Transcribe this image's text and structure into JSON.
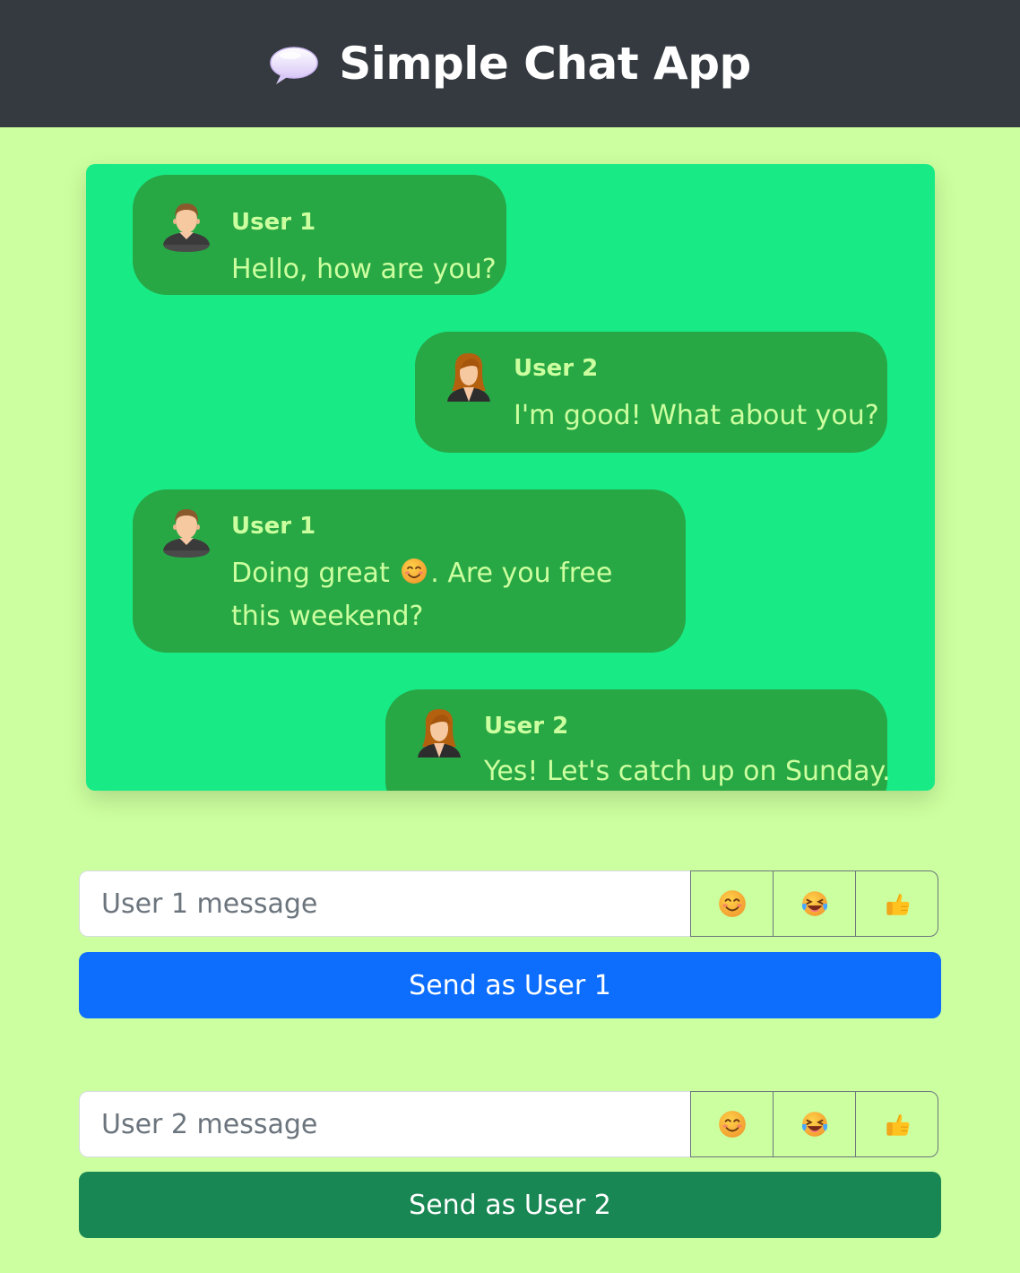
{
  "header": {
    "title": "Simple Chat App",
    "icon": "speech-bubble-icon"
  },
  "messages": [
    {
      "sender": "User 1",
      "text": "Hello, how are you?",
      "avatar": "male-avatar-icon"
    },
    {
      "sender": "User 2",
      "text": "I'm good! What about you?",
      "avatar": "female-avatar-icon"
    },
    {
      "sender": "User 1",
      "text_before": "Doing great",
      "text_emoji": "smiling-face-icon",
      "text_after": ". Are you free this weekend?",
      "avatar": "male-avatar-icon"
    },
    {
      "sender": "User 2",
      "text": "Yes! Let's catch up on Sunday.",
      "avatar": "female-avatar-icon"
    }
  ],
  "user1": {
    "placeholder": "User 1 message",
    "value": "",
    "emoji_buttons": [
      "smiling-face-icon",
      "tears-of-joy-icon",
      "thumbs-up-icon"
    ],
    "send_label": "Send as User 1",
    "send_color": "#0d6efd"
  },
  "user2": {
    "placeholder": "User 2 message",
    "value": "",
    "emoji_buttons": [
      "smiling-face-icon",
      "tears-of-joy-icon",
      "thumbs-up-icon"
    ],
    "send_label": "Send as User 2",
    "send_color": "#198754"
  },
  "colors": {
    "page_bg": "#ccff9f",
    "header_bg": "#343a40",
    "chat_bg": "#18eb86",
    "bubble_bg": "#28a745",
    "bubble_text": "#ccff9f"
  }
}
